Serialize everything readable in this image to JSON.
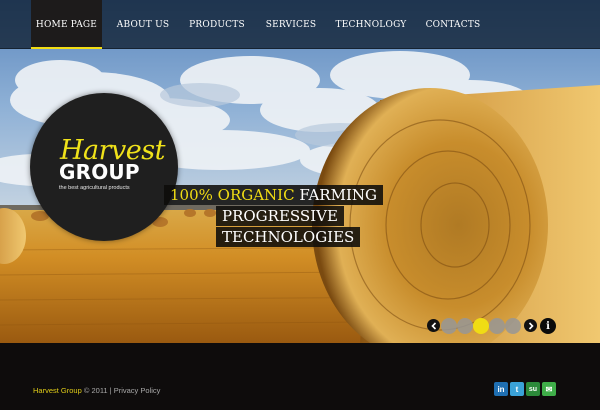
{
  "nav": {
    "items": [
      {
        "label": "HOME PAGE",
        "active": true
      },
      {
        "label": "ABOUT US",
        "active": false
      },
      {
        "label": "PRODUCTS",
        "active": false
      },
      {
        "label": "SERVICES",
        "active": false
      },
      {
        "label": "TECHNOLOGY",
        "active": false
      },
      {
        "label": "CONTACTS",
        "active": false
      }
    ]
  },
  "logo": {
    "name_first": "Harvest",
    "name_second": "GROUP",
    "tagline": "the best agricultural products"
  },
  "slogan": {
    "highlight": "100% ORGANIC",
    "line1_rest": " FARMING",
    "line2": "PROGRESSIVE",
    "line3": "TECHNOLOGIES"
  },
  "slider": {
    "total_slides": 5,
    "active_slide": 3,
    "prev_icon": "chevron-left-icon",
    "next_icon": "chevron-right-icon",
    "info_label": "i"
  },
  "footer": {
    "brand": "Harvest Group",
    "copyright": " © 2011 | ",
    "privacy": "Privacy Policy",
    "social": [
      {
        "name": "linkedin-icon",
        "glyph": "in",
        "color": "#1f6fb2"
      },
      {
        "name": "twitter-icon",
        "glyph": "t",
        "color": "#3aa2d8"
      },
      {
        "name": "stumbleupon-icon",
        "glyph": "su",
        "color": "#2c8a3a"
      },
      {
        "name": "chat-icon",
        "glyph": "✉",
        "color": "#3fae49"
      }
    ]
  },
  "colors": {
    "accent": "#f0dc14",
    "nav_bg": "#0b1a2b",
    "footer_bg": "#0e0c0c"
  }
}
